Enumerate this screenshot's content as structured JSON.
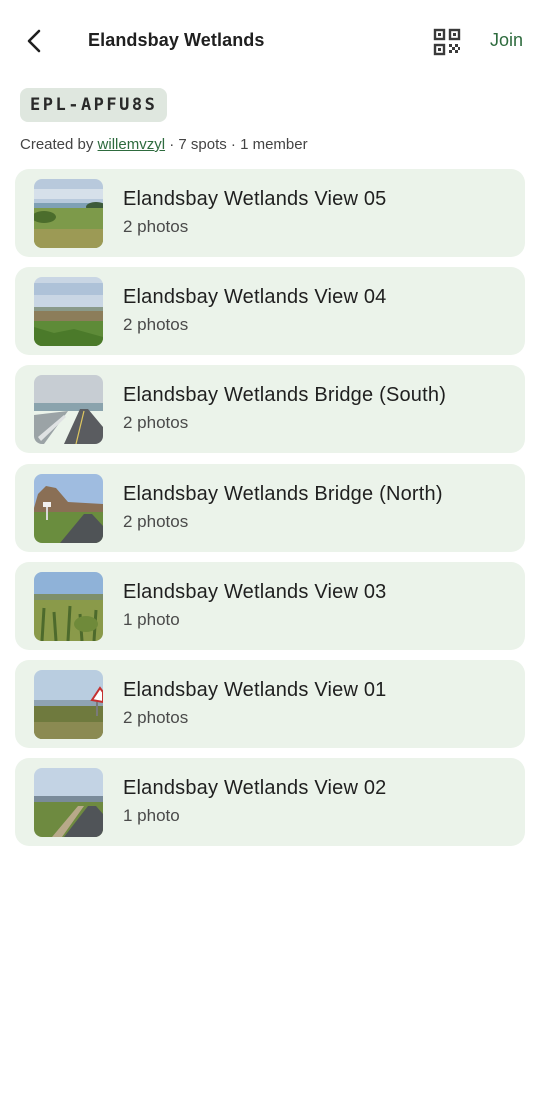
{
  "header": {
    "title": "Elandsbay Wetlands",
    "join_label": "Join",
    "back_icon": "chevron-left-icon",
    "qr_icon": "qr-code-icon"
  },
  "code": "EPL-APFU8S",
  "meta": {
    "created_by_prefix": "Created by ",
    "creator": "willemvzyl",
    "spots": " · 7 spots",
    "members": " · 1 member"
  },
  "colors": {
    "accent": "#2e6b3e",
    "card_bg": "#ebf3ea",
    "chip_bg": "#dfe7df"
  },
  "spots": [
    {
      "name": "Elandsbay Wetlands View 05",
      "count": "2 photos",
      "thumb": "wetland-shore"
    },
    {
      "name": "Elandsbay Wetlands View 04",
      "count": "2 photos",
      "thumb": "wetland-grass"
    },
    {
      "name": "Elandsbay Wetlands Bridge (South)",
      "count": "2 photos",
      "thumb": "bridge-road"
    },
    {
      "name": "Elandsbay Wetlands Bridge (North)",
      "count": "2 photos",
      "thumb": "mountain-road"
    },
    {
      "name": "Elandsbay Wetlands View 03",
      "count": "1 photo",
      "thumb": "fynbos-field"
    },
    {
      "name": "Elandsbay Wetlands View 01",
      "count": "2 photos",
      "thumb": "road-sign"
    },
    {
      "name": "Elandsbay Wetlands View 02",
      "count": "1 photo",
      "thumb": "coastal-road"
    }
  ]
}
